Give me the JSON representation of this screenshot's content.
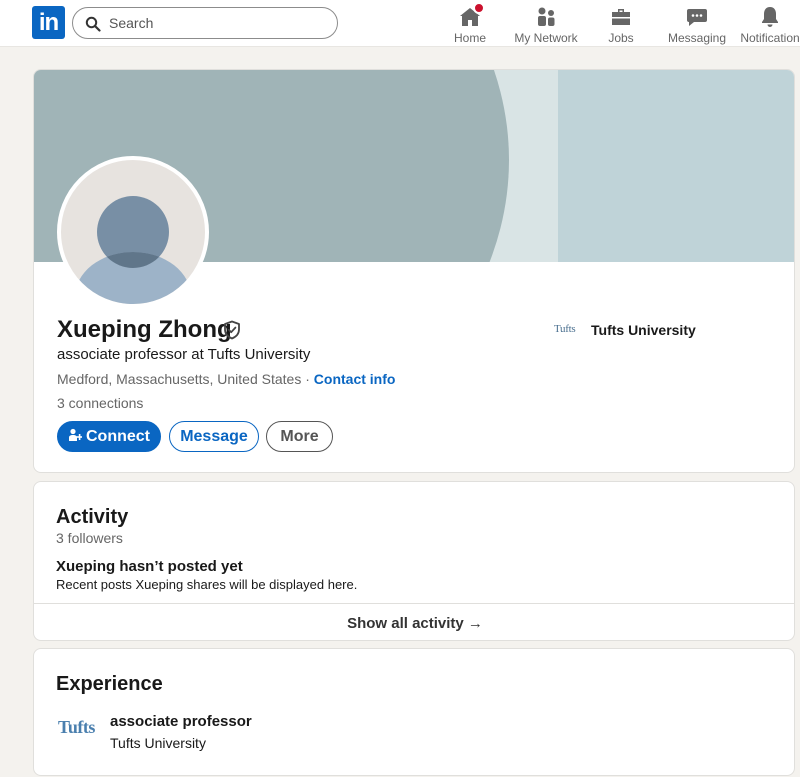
{
  "nav": {
    "logo": "in",
    "search_placeholder": "Search",
    "items": [
      {
        "label": "Home",
        "icon": "home-icon"
      },
      {
        "label": "My Network",
        "icon": "network-icon"
      },
      {
        "label": "Jobs",
        "icon": "briefcase-icon"
      },
      {
        "label": "Messaging",
        "icon": "chat-icon"
      },
      {
        "label": "Notification",
        "icon": "bell-icon"
      }
    ]
  },
  "profile": {
    "name": "Xueping Zhong",
    "headline": "associate professor at Tufts University",
    "location": "Medford, Massachusetts, United States",
    "separator": " · ",
    "contact_info": "Contact info",
    "connections": "3 connections",
    "education": {
      "logo_text": "Tufts",
      "name": "Tufts University"
    },
    "buttons": {
      "connect": "Connect",
      "message": "Message",
      "more": "More"
    }
  },
  "activity": {
    "title": "Activity",
    "followers": "3 followers",
    "empty_title": "Xueping hasn’t posted yet",
    "empty_subtitle": "Recent posts Xueping shares will be displayed here.",
    "show_all": "Show all activity →"
  },
  "experience": {
    "title": "Experience",
    "items": [
      {
        "logo_text": "Tufts",
        "role": "associate professor",
        "org": "Tufts University"
      }
    ]
  },
  "colors": {
    "accent": "#0a66c2",
    "notification_badge": "#cb112d",
    "page_bg": "#f4f2ee"
  }
}
